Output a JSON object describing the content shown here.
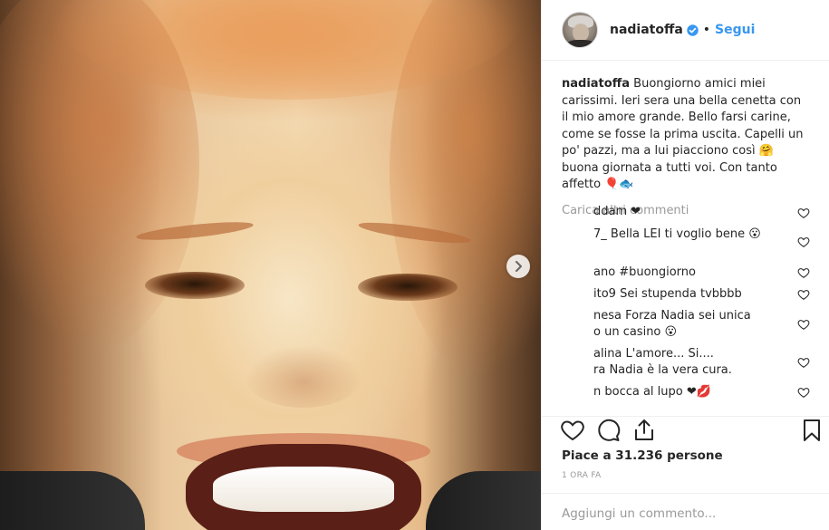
{
  "post": {
    "photo_alt": "",
    "next_icon": "chevron-right-icon"
  },
  "header": {
    "username": "nadiatoffa",
    "separator": "•",
    "follow_label": "Segui",
    "verified_icon": "verified-badge-icon",
    "accent_color": "#3897f0"
  },
  "caption": {
    "username": "nadiatoffa",
    "text": "Buongiorno amici miei carissimi. Ieri sera una bella cenetta con il mio amore grande. Bello farsi carine, come se fosse la prima uscita. Capelli un po' pazzi, ma a lui piacciono così 🤗 buona giornata a tutti voi. Con tanto affetto 🎈🐟"
  },
  "load_more_label": "Carica altri commenti",
  "comments": [
    {
      "text": "ddam ❤"
    },
    {
      "text": "7_ Bella LEI ti voglio bene 😮"
    },
    {
      "text": "ano #buongiorno"
    },
    {
      "text": "ito9 Sei stupenda tvbbbb"
    },
    {
      "line1": "nesa Forza Nadia sei unica",
      "line2": "o un casino 😮"
    },
    {
      "line1": "alina L'amore... Si....",
      "line2": "ra Nadia è la vera cura."
    },
    {
      "text": "n bocca al lupo ❤💋"
    }
  ],
  "actions": {
    "like_icon": "heart-icon",
    "comment_icon": "comment-icon",
    "share_icon": "share-icon",
    "save_icon": "bookmark-icon"
  },
  "likes_text": "Piace a 31.236 persone",
  "time_text": "1 ORA FA",
  "add_comment": {
    "placeholder": "Aggiungi un commento..."
  }
}
